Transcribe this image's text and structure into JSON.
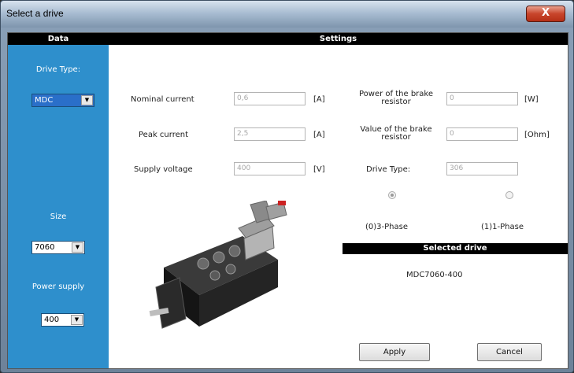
{
  "window": {
    "title": "Select a drive",
    "close_glyph": "X"
  },
  "header": {
    "data_label": "Data",
    "settings_label": "Settings"
  },
  "sidebar": {
    "drive_type_label": "Drive Type:",
    "drive_type_value": "MDC",
    "size_label": "Size",
    "size_value": "7060",
    "power_supply_label": "Power supply",
    "power_supply_value": "400"
  },
  "settings": {
    "nominal_current": {
      "label": "Nominal current",
      "value": "0,6",
      "unit": "[A]"
    },
    "peak_current": {
      "label": "Peak current",
      "value": "2,5",
      "unit": "[A]"
    },
    "supply_voltage": {
      "label": "Supply voltage",
      "value": "400",
      "unit": "[V]"
    },
    "brake_power": {
      "label": "Power of the brake resistor",
      "value": "0",
      "unit": "[W]"
    },
    "brake_value": {
      "label": "Value of the brake resistor",
      "value": "0",
      "unit": "[Ohm]"
    },
    "drive_type": {
      "label": "Drive Type:",
      "value": "306"
    },
    "phase_options": [
      {
        "label": "(0)3-Phase",
        "selected": true
      },
      {
        "label": "(1)1-Phase",
        "selected": false
      }
    ]
  },
  "selected_drive": {
    "header": "Selected drive",
    "value": "MDC7060-400"
  },
  "buttons": {
    "apply": "Apply",
    "cancel": "Cancel"
  },
  "icons": {
    "close": "close-icon",
    "dropdown": "chevron-down-icon",
    "product": "servo-motor-image"
  }
}
